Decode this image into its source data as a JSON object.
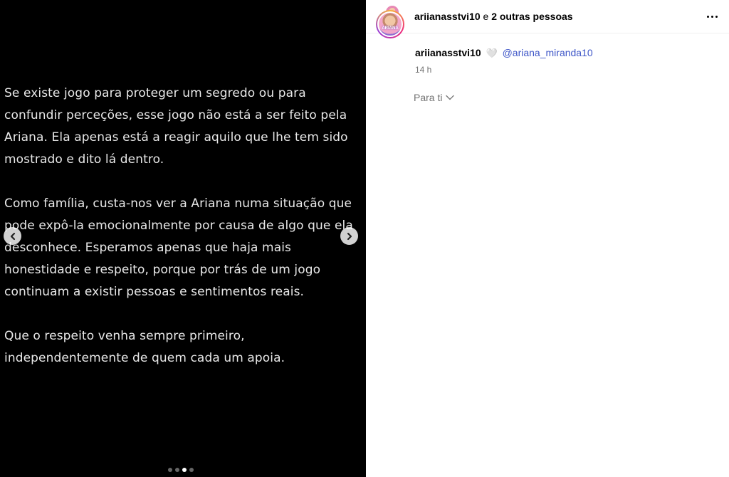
{
  "post": {
    "paragraphs": [
      "Se existe jogo para proteger um segredo ou para\nconfundir perceções, esse jogo não está a ser feito pela\nAriana. Ela apenas está a reagir aquilo que lhe tem sido\nmostrado e dito lá dentro.",
      "Como família, custa-nos ver a Ariana numa situação que\npode expô-la emocionalmente por causa de algo que ela\ndesconhece. Esperamos apenas que haja mais\nhonestidade e respeito, porque por trás de um jogo\ncontinuam a existir pessoas e sentimentos reais.",
      "Que o respeito venha sempre primeiro,\nindependentemente de quem cada um apoia."
    ],
    "carousel": {
      "total": 4,
      "active_index": 2
    }
  },
  "header": {
    "username": "ariianasstvi10",
    "connector": "e",
    "others": "2 outras pessoas"
  },
  "caption": {
    "avatar_label": "ARIANA",
    "username": "ariianasstvi10",
    "heart": "🤍",
    "mention": "@ariana_miranda10",
    "time": "14 h"
  },
  "translation": {
    "label": "Para ti"
  },
  "icons": {
    "prev": "chevron-left-icon",
    "next": "chevron-right-icon",
    "more": "more-options-icon",
    "dropdown": "chevron-down-icon"
  }
}
